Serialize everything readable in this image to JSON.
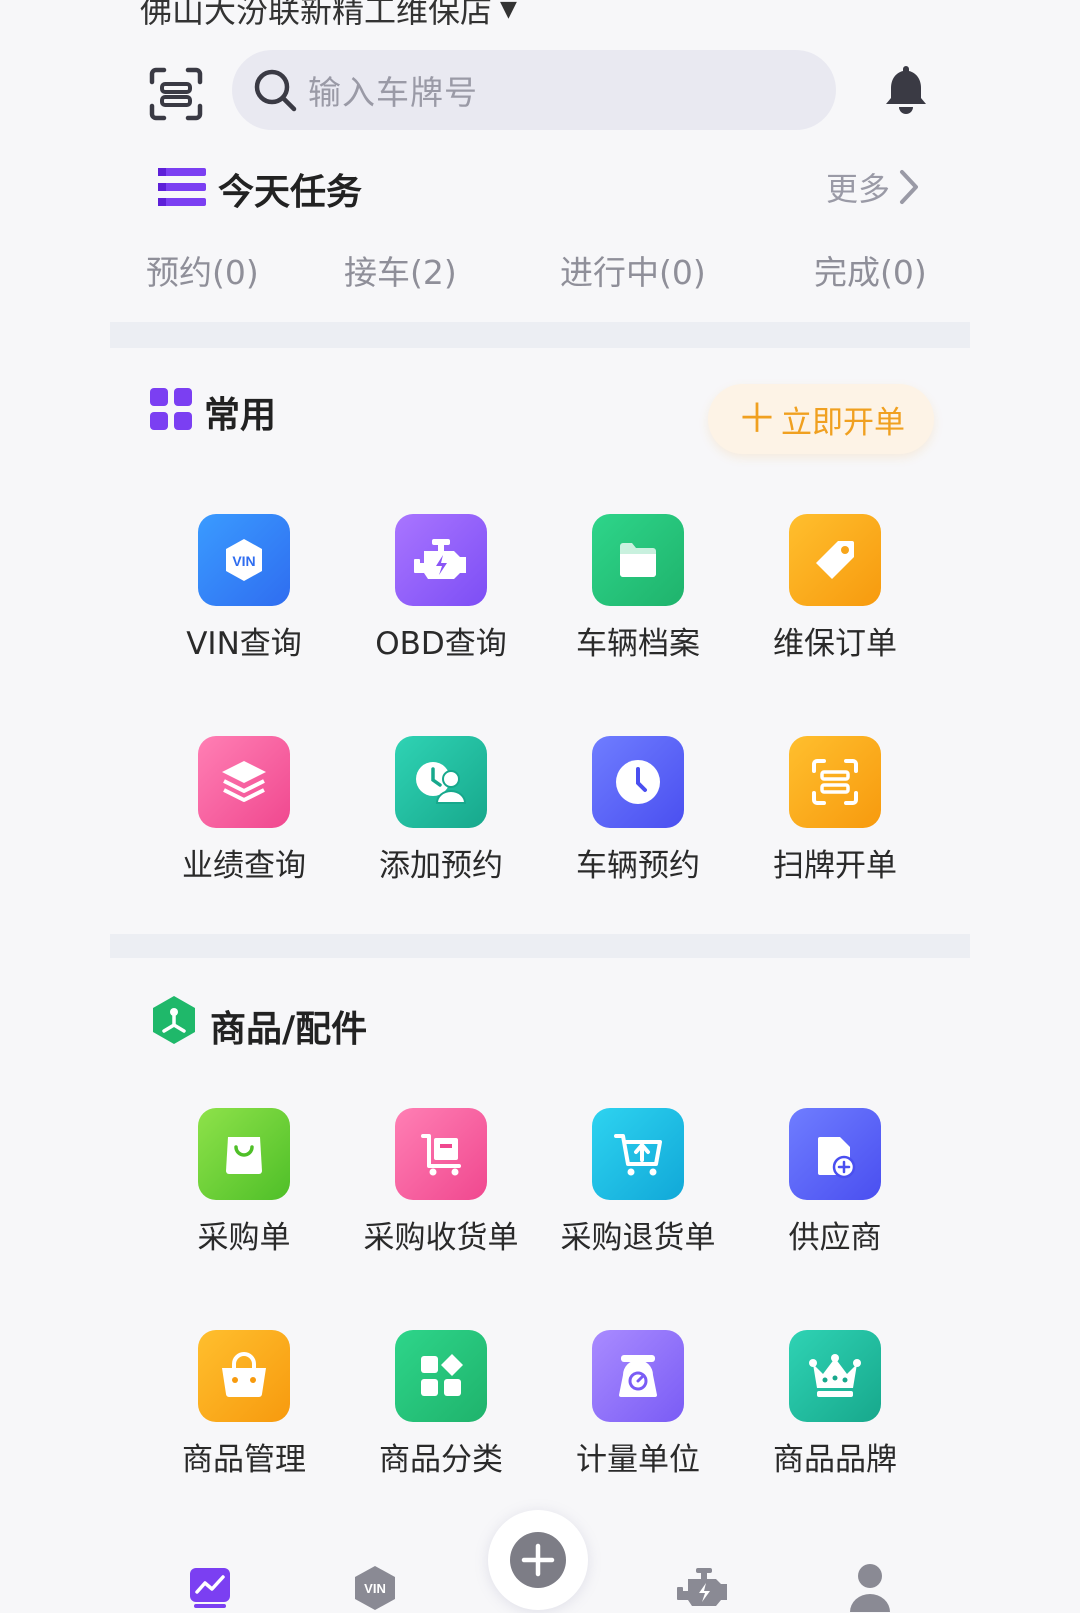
{
  "header": {
    "store_name": "佛山大汾联新精工维保店",
    "search_placeholder": "输入车牌号"
  },
  "today": {
    "title": "今天任务",
    "more_label": "更多",
    "tabs": [
      "预约(0)",
      "接车(2)",
      "进行中(0)",
      "完成(0)"
    ]
  },
  "common": {
    "title": "常用",
    "open_order_label": "立即开单",
    "items": [
      {
        "label": "VIN查询",
        "icon": "vin-icon",
        "color": "#3a7df5"
      },
      {
        "label": "OBD查询",
        "icon": "engine-icon",
        "color": "#8b5cf6"
      },
      {
        "label": "车辆档案",
        "icon": "folder-icon",
        "color": "#22c47a"
      },
      {
        "label": "维保订单",
        "icon": "tag-icon",
        "color": "#f7a51a"
      },
      {
        "label": "业绩查询",
        "icon": "layers-icon",
        "color": "#f0589a"
      },
      {
        "label": "添加预约",
        "icon": "appointment-user-icon",
        "color": "#1fbf9f"
      },
      {
        "label": "车辆预约",
        "icon": "clock-icon",
        "color": "#5561f5"
      },
      {
        "label": "扫牌开单",
        "icon": "scan-icon",
        "color": "#f7a51a"
      }
    ]
  },
  "parts": {
    "title": "商品/配件",
    "items": [
      {
        "label": "采购单",
        "icon": "shopping-bag-icon",
        "color": "#5ccf33"
      },
      {
        "label": "采购收货单",
        "icon": "cart-receive-icon",
        "color": "#f0589a"
      },
      {
        "label": "采购退货单",
        "icon": "cart-return-icon",
        "color": "#1fb8e0"
      },
      {
        "label": "供应商",
        "icon": "supplier-doc-icon",
        "color": "#5561f5"
      },
      {
        "label": "商品管理",
        "icon": "basket-icon",
        "color": "#f7a51a"
      },
      {
        "label": "商品分类",
        "icon": "category-grid-icon",
        "color": "#22c47a"
      },
      {
        "label": "计量单位",
        "icon": "scale-icon",
        "color": "#8b5cf6"
      },
      {
        "label": "商品品牌",
        "icon": "crown-icon",
        "color": "#1fbf9f"
      }
    ]
  },
  "bottom_nav": {
    "vin_badge": "VIN"
  },
  "icon_text": {
    "vin": "VIN"
  }
}
